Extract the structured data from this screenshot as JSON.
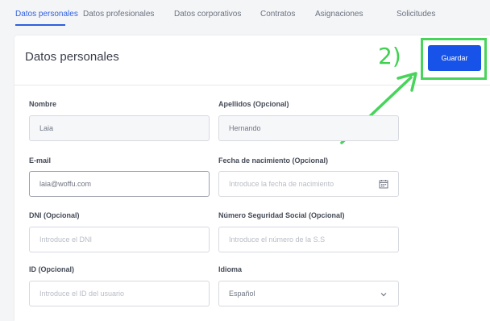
{
  "tabs": [
    {
      "label": "Datos personales",
      "active": true
    },
    {
      "label": "Datos profesionales"
    },
    {
      "label": "Datos corporativos"
    },
    {
      "label": "Contratos"
    },
    {
      "label": "Asignaciones"
    },
    {
      "label": "Solicitudes"
    }
  ],
  "card": {
    "title": "Datos personales",
    "save_label": "Guardar"
  },
  "annotation": {
    "label": "2)",
    "color": "#47d45a"
  },
  "fields": {
    "nombre": {
      "label": "Nombre",
      "value": "Laia"
    },
    "apellidos": {
      "label": "Apellidos (Opcional)",
      "value": "Hernando"
    },
    "email": {
      "label": "E-mail",
      "value": "laia@woffu.com"
    },
    "fecha": {
      "label": "Fecha de nacimiento (Opcional)",
      "placeholder": "Introduce la fecha de nacimiento",
      "icon": "calendar-icon"
    },
    "dni": {
      "label": "DNI (Opcional)",
      "placeholder": "Introduce el DNI"
    },
    "nss": {
      "label": "Número Seguridad Social (Opcional)",
      "placeholder": "Introduce el número de la S.S"
    },
    "id": {
      "label": "ID (Opcional)",
      "placeholder": "Introduce el ID del usuario"
    },
    "idioma": {
      "label": "Idioma",
      "value": "Español",
      "icon": "chevron-down-icon"
    }
  },
  "colors": {
    "accent": "#1753e8",
    "active_tab": "#2f5fe0"
  }
}
